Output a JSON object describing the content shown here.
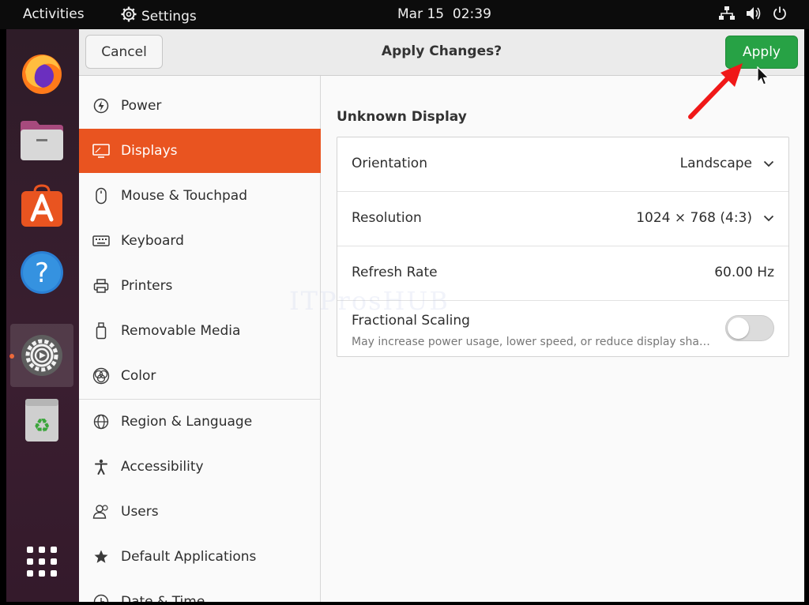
{
  "topbar": {
    "activities": "Activities",
    "app_name": "Settings",
    "clock": "Mar 15  02:39",
    "icons": [
      "network-icon",
      "volume-icon",
      "power-icon"
    ]
  },
  "dock": {
    "apps": [
      "firefox-icon",
      "files-icon",
      "software-center-icon",
      "help-icon",
      "settings-icon",
      "trash-icon",
      "show-apps-icon"
    ],
    "running_indicator_color": "#e95420"
  },
  "header": {
    "cancel_label": "Cancel",
    "title": "Apply Changes?",
    "apply_label": "Apply",
    "apply_color": "#27a245"
  },
  "sidebar": {
    "selected_color": "#e95420",
    "items": [
      {
        "label": "Power",
        "icon": "power-bolt-icon"
      },
      {
        "label": "Displays",
        "icon": "display-icon",
        "selected": true
      },
      {
        "label": "Mouse & Touchpad",
        "icon": "mouse-icon"
      },
      {
        "label": "Keyboard",
        "icon": "keyboard-icon"
      },
      {
        "label": "Printers",
        "icon": "printer-icon"
      },
      {
        "label": "Removable Media",
        "icon": "removable-media-icon"
      },
      {
        "label": "Color",
        "icon": "color-icon"
      },
      {
        "label": "Region & Language",
        "icon": "globe-icon"
      },
      {
        "label": "Accessibility",
        "icon": "accessibility-icon"
      },
      {
        "label": "Users",
        "icon": "users-icon"
      },
      {
        "label": "Default Applications",
        "icon": "star-icon"
      },
      {
        "label": "Date & Time",
        "icon": "clock-icon"
      }
    ]
  },
  "display": {
    "title": "Unknown Display",
    "orientation": {
      "label": "Orientation",
      "value": "Landscape"
    },
    "resolution": {
      "label": "Resolution",
      "value": "1024 × 768 (4:3)"
    },
    "refresh_rate": {
      "label": "Refresh Rate",
      "value": "60.00 Hz"
    },
    "fractional_scaling": {
      "label": "Fractional Scaling",
      "description": "May increase power usage, lower speed, or reduce display sharpness.",
      "enabled": false
    }
  },
  "watermark": "ITProsHUB"
}
